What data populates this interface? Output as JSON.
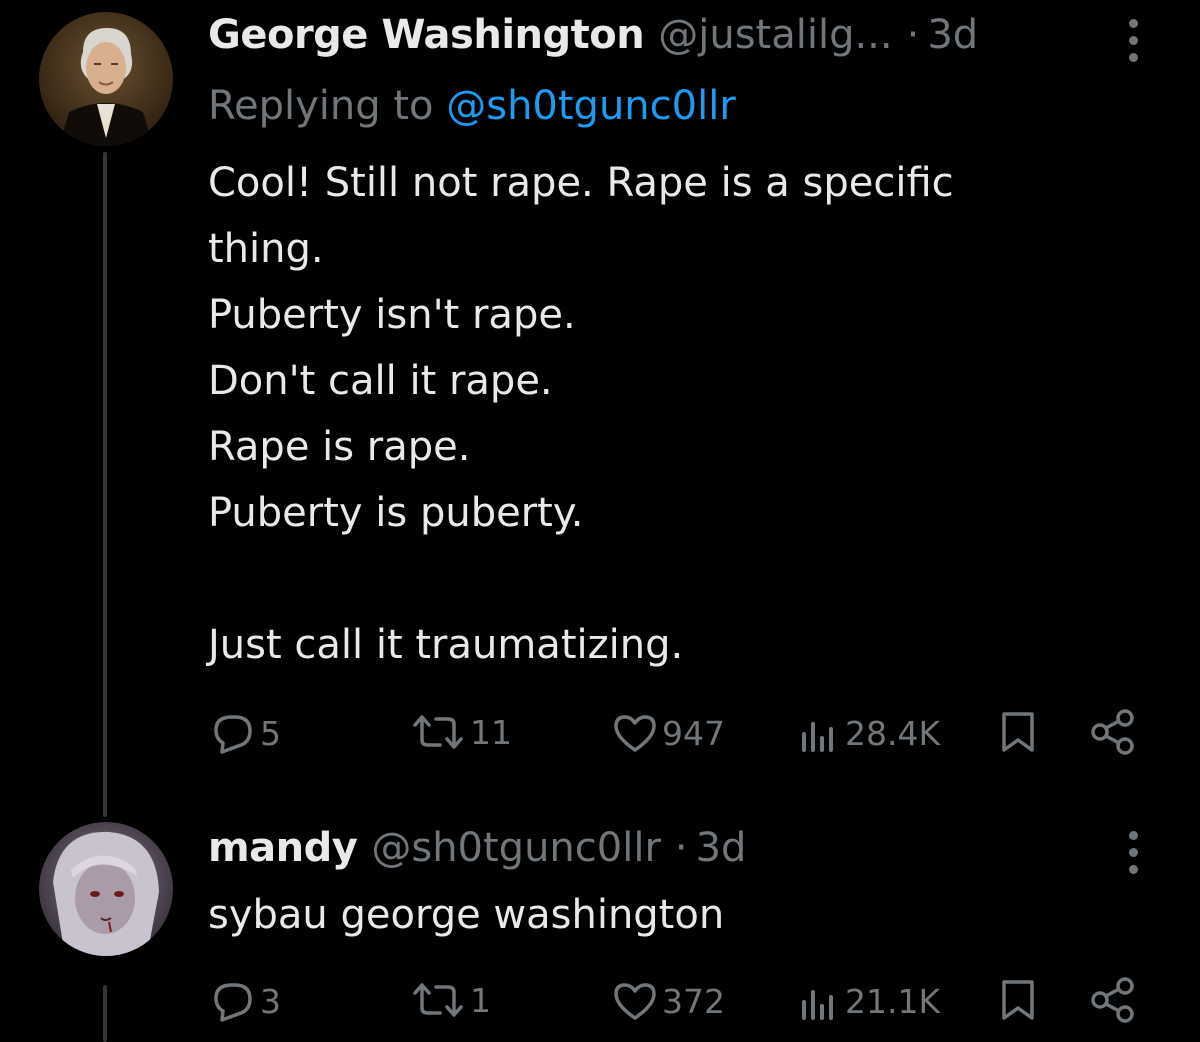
{
  "tweets": [
    {
      "author_name": "George Washington",
      "handle": "@justalilg...",
      "separator": "·",
      "time": "3d",
      "replying_prefix": "Replying to",
      "replying_to": "@sh0tgunc0llr",
      "text": "Cool! Still not rape. Rape is a specific\nthing.\nPuberty isn't rape.\nDon't call it rape.\nRape is rape.\nPuberty is puberty.\n\nJust call it traumatizing.",
      "replies": "5",
      "reposts": "11",
      "likes": "947",
      "views": "28.4K",
      "avatar_icon": "george-washington-portrait"
    },
    {
      "author_name": "mandy",
      "handle": "@sh0tgunc0llr",
      "separator": "·",
      "time": "3d",
      "text": "sybau george washington",
      "replies": "3",
      "reposts": "1",
      "likes": "372",
      "views": "21.1K",
      "avatar_icon": "anime-character-portrait"
    }
  ],
  "colors": {
    "background": "#000000",
    "text": "#e7e9ea",
    "muted": "#71767b",
    "link": "#1d9bf0",
    "thread_line": "#333639"
  },
  "icons": [
    "reply-icon",
    "repost-icon",
    "like-icon",
    "views-icon",
    "bookmark-icon",
    "share-icon",
    "more-icon"
  ]
}
